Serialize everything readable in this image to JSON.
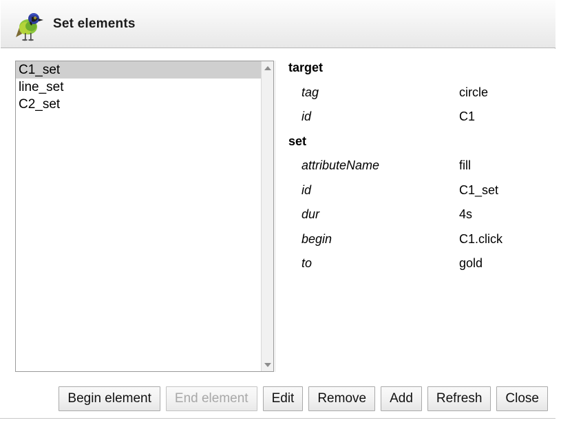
{
  "window": {
    "title": "Set elements",
    "icon": "green-jay-bird-icon"
  },
  "list": {
    "items": [
      {
        "label": "C1_set",
        "selected": true
      },
      {
        "label": "line_set",
        "selected": false
      },
      {
        "label": "C2_set",
        "selected": false
      }
    ],
    "scrollbar": {
      "up_arrow": "scroll-up-arrow",
      "down_arrow": "scroll-down-arrow"
    }
  },
  "details": {
    "rows": [
      {
        "type": "group",
        "key": "target",
        "value": ""
      },
      {
        "type": "prop",
        "key": "tag",
        "value": "circle"
      },
      {
        "type": "prop",
        "key": "id",
        "value": "C1"
      },
      {
        "type": "group",
        "key": "set",
        "value": ""
      },
      {
        "type": "prop",
        "key": "attributeName",
        "value": "fill"
      },
      {
        "type": "prop",
        "key": "id",
        "value": "C1_set"
      },
      {
        "type": "prop",
        "key": "dur",
        "value": "4s"
      },
      {
        "type": "prop",
        "key": "begin",
        "value": "C1.click"
      },
      {
        "type": "prop",
        "key": "to",
        "value": "gold"
      }
    ]
  },
  "buttons": [
    {
      "label": "Begin element",
      "disabled": false
    },
    {
      "label": "End element",
      "disabled": true
    },
    {
      "label": "Edit",
      "disabled": false
    },
    {
      "label": "Remove",
      "disabled": false
    },
    {
      "label": "Add",
      "disabled": false
    },
    {
      "label": "Refresh",
      "disabled": false
    },
    {
      "label": "Close",
      "disabled": false
    }
  ],
  "colors": {
    "selection": "#cfcfcf",
    "titlebar_bottom": "#e8e8e8",
    "border": "#9a9a9a"
  }
}
